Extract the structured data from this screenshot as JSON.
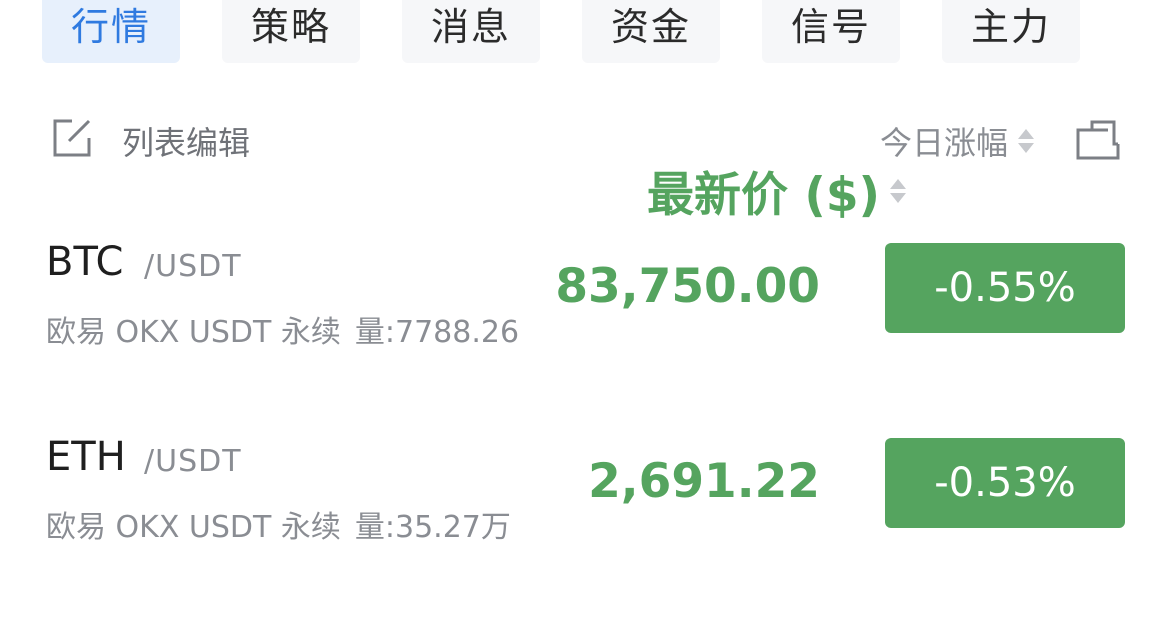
{
  "tabs": [
    {
      "label": "行情",
      "active": true
    },
    {
      "label": "策略",
      "active": false
    },
    {
      "label": "消息",
      "active": false
    },
    {
      "label": "资金",
      "active": false
    },
    {
      "label": "信号",
      "active": false
    },
    {
      "label": "主力",
      "active": false
    }
  ],
  "toolbar": {
    "edit_label": "列表编辑",
    "price_header": "最新价 ($)",
    "change_header": "今日涨幅",
    "edit_icon": "edit-icon",
    "share_icon": "share-icon"
  },
  "rows": [
    {
      "symbol": "BTC",
      "quote": "/USDT",
      "exchange": "欧易 OKX USDT 永续",
      "volume": "量:7788.26",
      "price": "83,750.00",
      "change": "-0.55%"
    },
    {
      "symbol": "ETH",
      "quote": "/USDT",
      "exchange": "欧易 OKX USDT 永续",
      "volume": "量:35.27万",
      "price": "2,691.22",
      "change": "-0.53%"
    }
  ],
  "colors": {
    "accent": "#2f7ae0",
    "tab_active_bg": "#e7f0fc",
    "up_green": "#55a45f",
    "muted_text": "#8a8d93"
  }
}
